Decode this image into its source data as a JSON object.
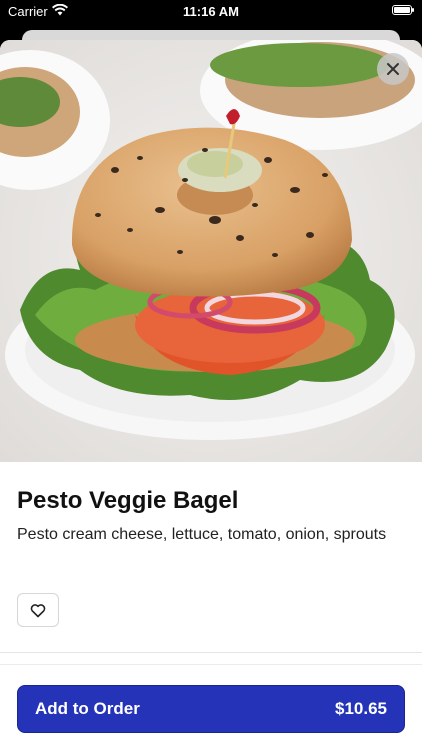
{
  "status_bar": {
    "carrier": "Carrier",
    "time": "11:16 AM",
    "battery_level": 1.0
  },
  "item": {
    "name": "Pesto Veggie Bagel",
    "description": "Pesto cream cheese, lettuce, tomato, onion, sprouts",
    "image_alt": "Pesto veggie bagel sandwich on a white plate"
  },
  "icons": {
    "close": "close-icon",
    "favorite": "heart-icon",
    "wifi": "wifi-icon",
    "battery": "battery-icon"
  },
  "footer": {
    "add_label": "Add to Order",
    "price": "$10.65"
  },
  "colors": {
    "primary_button": "#2433b8",
    "text": "#111111"
  }
}
